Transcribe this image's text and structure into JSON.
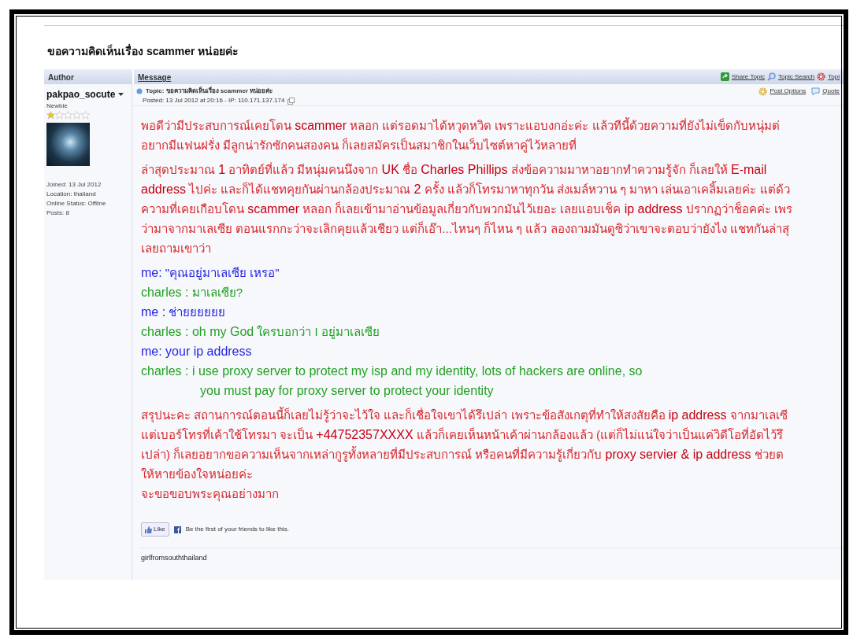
{
  "page_title": "ขอความคิดเห็นเรื่อง scammer หน่อยค่ะ",
  "table": {
    "columns": [
      "Author",
      "Message"
    ]
  },
  "topic_actions": [
    {
      "kind": "share",
      "label": "Share Topic"
    },
    {
      "kind": "search",
      "label": "Topic Search"
    },
    {
      "kind": "gear",
      "label": "Topi"
    }
  ],
  "post": {
    "author": {
      "name": "pakpao_socute",
      "rank": "Newbie",
      "stars": 1,
      "details": [
        "Joined: 13 Jul 2012",
        "Location: thailand",
        "Online Status: Offline",
        "Posts: 8"
      ]
    },
    "topic": "Topic: ขอความคิดเห็นเรื่อง scammer หน่อยค่ะ",
    "posted": "Posted: 13 Jul 2012 at 20:16 - IP: 110.171.137.174",
    "actions": [
      {
        "kind": "options",
        "label": "Post Options"
      },
      {
        "kind": "quote",
        "label": "Quote"
      }
    ],
    "body": [
      {
        "kind": "paragraph",
        "lines": [
          "พอดีว่ามีประสบการณ์เคยโดน **scammer** หลอก แต่รอดมาได้หวุดหวิด เพราะแอบงกอ่ะค่ะ แล้วทีนี้ด้วยความที่ยังไม่เข็ดกับหนุ่มต่",
          "อยากมีแฟนฝรั่ง มีลูกน่ารักซักคนสองคน ก็เลยสมัครเป็นสมาชิกในเว็บไซต์หาคู่ไว้หลายที่"
        ]
      },
      {
        "kind": "paragraph",
        "lines": [
          "ล่าสุดประมาณ **1** อาทิตย์ที่แล้ว มีหนุ่มคนนึงจาก **UK** ชื่อ **Charles Phillips** ส่งข้อความมาหาอยากทำความรู้จัก ก็เลยให้ **E-mail**",
          "**address** ไปค่ะ และก็ได้แชทคุยกันผ่านกล้องประมาณ **2** ครั้ง แล้วก็โทรมาหาทุกวัน ส่งเมล์หวาน ๆ มาหา เล่นเอาเคลิ้มเลยค่ะ  แต่ด้ว",
          "ความที่เคยเกือบโดน **scammer** หลอก ก็เลยเข้ามาอ่านข้อมูลเกี่ยวกับพวกมันไว้เยอะ เลยแอบเช็ค **ip address** ปรากฏว่าช็อคค่ะ เพร",
          "ว่ามาจากมาเลเซีย ตอนแรกกะว่าจะเลิกคุยแล้วเชียว แต่ก็เอ๊า...ไหนๆ ก็ไหน ๆ แล้ว ลองถามมันดูซิว่าเขาจะตอบว่ายังไง แชทกันล่าสุ",
          "เลยถามเขาว่า"
        ]
      },
      {
        "kind": "chat",
        "messages": [
          {
            "kind": "me",
            "lines": [
              "**me:** \"คุณอยู่มาเลเซีย เหรอ\""
            ]
          },
          {
            "kind": "other",
            "lines": [
              "**charles :** มาเลเซีย?"
            ]
          },
          {
            "kind": "me",
            "lines": [
              "**me :** ช่ายยยยยย"
            ]
          },
          {
            "kind": "other",
            "lines": [
              "**charles : oh my God** ใครบอกว่า I อยู่มาเลเซีย"
            ]
          },
          {
            "kind": "me",
            "lines": [
              "**me:  your ip address**"
            ]
          },
          {
            "kind": "other",
            "lines": [
              "**charles : i use proxy server to protect my isp and my identity, lots of hackers are online, so**",
              "**you must pay for proxy server to protect your identity**"
            ]
          }
        ]
      },
      {
        "kind": "paragraph",
        "lines": [
          " สรุปนะคะ สถานการณ์ตอนนี้ก็เลยไม่รู้ว่าจะไว้ใจ และก็เชื่อใจเขาได้รึเปล่า เพราะข้อสังเกตุที่ทำให้สงสัยคือ **ip address** จากมาเลเซี",
          "แต่เบอร์โทรที่เค้าใช้โทรมา จะเป็น **+44752357XXXX**  แล้วก็เคยเห็นหน้าเค้าผ่านกล้องแล้ว (แต่ก็ไม่แน่ใจว่าเป็นแค่วิดีโอที่อัดไว้รึ",
          "เปล่า)  ก็เลยอยากขอความเห็นจากเหล่ากูรูทั้งหลายที่มีประสบการณ์ หรือคนที่มีความรู้เกี่ยวกับ **proxy servier & ip address** ช่วยต",
          "ให้หายข้องใจหน่อยค่ะ",
          "จะขอขอบพระคุณอย่างมาก"
        ]
      }
    ],
    "like": {
      "label": "Like",
      "text": "Be the first of your friends to like this."
    },
    "signature": "girlfromsouththailand"
  }
}
